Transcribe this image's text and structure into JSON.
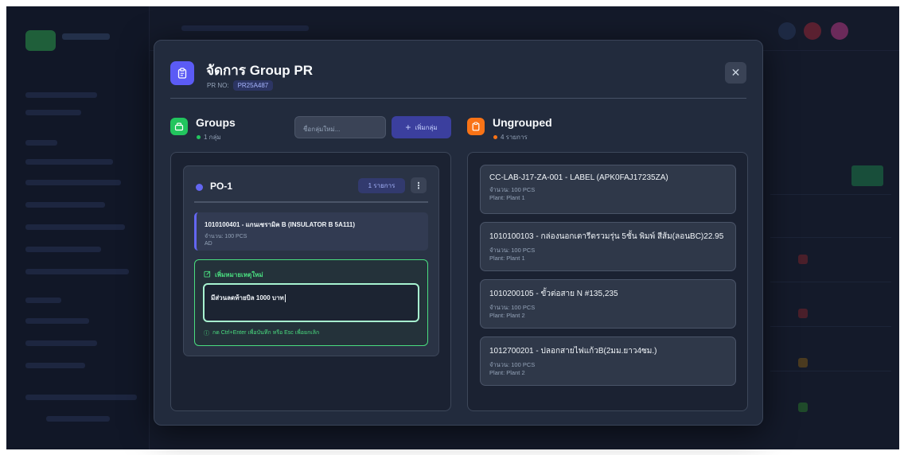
{
  "modal": {
    "title": "จัดการ Group PR",
    "pr_no_label": "PR NO:",
    "pr_no_value": "PR25A487",
    "close_icon": "close-icon"
  },
  "groups_section": {
    "title": "Groups",
    "count_label": "1 กลุ่ม",
    "new_group_placeholder": "ชื่อกลุ่มใหม่...",
    "add_button_label": "เพิ่มกลุ่ม",
    "accent_color": "#22c55e"
  },
  "group": {
    "name": "PO-1",
    "count_badge": "1 รายการ",
    "dot_color": "#6366f1",
    "items": [
      {
        "title": "1010100401 - แกนเซรามิค B (INSULATOR B 5A111)",
        "quantity": "จำนวน: 100 PCS",
        "note": "AD"
      }
    ],
    "note_editor": {
      "label": "เพิ่มหมายเหตุใหม่",
      "value": "มีส่วนลดท้ายบิล 1000 บาท",
      "hint": "กด Ctrl+Enter เพื่อบันทึก หรือ Esc เพื่อยกเลิก"
    }
  },
  "ungrouped_section": {
    "title": "Ungrouped",
    "count_label": "4 รายการ",
    "accent_color": "#f97316",
    "items": [
      {
        "title": "CC-LAB-J17-ZA-001 - LABEL (APK0FAJ17235ZA)",
        "quantity": "จำนวน: 100 PCS",
        "plant": "Plant: Plant 1"
      },
      {
        "title": "1010100103 - กล่องนอกเตารีดรวมรุ่น 5ชั้น พิมพ์ สีส้ม(ลอนBC)22.95",
        "quantity": "จำนวน: 100 PCS",
        "plant": "Plant: Plant 1"
      },
      {
        "title": "1010200105 - ขั้วต่อสาย N #135,235",
        "quantity": "จำนวน: 100 PCS",
        "plant": "Plant: Plant 2"
      },
      {
        "title": "1012700201 - ปลอกสายไฟแก้วB(2มม.ยาว4ซม.)",
        "quantity": "จำนวน: 100 PCS",
        "plant": "Plant: Plant 2"
      }
    ]
  }
}
